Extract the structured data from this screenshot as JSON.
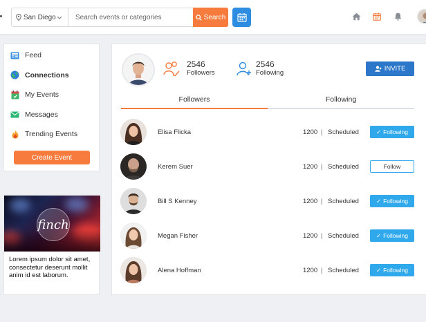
{
  "header": {
    "location": "San Diego",
    "search_placeholder": "Search events or categories",
    "search_label": "Search",
    "icons": [
      "calendar-icon",
      "home-icon",
      "calendar-icon",
      "bell-icon"
    ],
    "accent": "#f67b3c",
    "brand_blue": "#2e8de0"
  },
  "sidebar": {
    "items": [
      {
        "label": "Feed",
        "icon": "newspaper-icon"
      },
      {
        "label": "Connections",
        "icon": "globe-icon",
        "active": true
      },
      {
        "label": "My Events",
        "icon": "calendar-icon"
      },
      {
        "label": "Messages",
        "icon": "mail-icon"
      },
      {
        "label": "Trending Events",
        "icon": "fire-icon"
      }
    ],
    "create_label": "Create Event"
  },
  "ad": {
    "logo_text": "finch",
    "text": "Lorem ipsum dolor sit amet, consectetur deserunt mollit anim id est laborum."
  },
  "profile": {
    "followers_count": "2546",
    "followers_label": "Followers",
    "following_count": "2546",
    "following_label": "Following",
    "invite_label": "INVITE"
  },
  "tabs": [
    {
      "label": "Followers",
      "active": true
    },
    {
      "label": "Following",
      "active": false
    }
  ],
  "followers": [
    {
      "name": "Elisa Flicka",
      "count": "1200",
      "status": "Scheduled",
      "button": "Following",
      "following": true
    },
    {
      "name": "Kerem Suer",
      "count": "1200",
      "status": "Scheduled",
      "button": "Follow",
      "following": false
    },
    {
      "name": "Bill S Kenney",
      "count": "1200",
      "status": "Scheduled",
      "button": "Following",
      "following": true
    },
    {
      "name": "Megan Fisher",
      "count": "1200",
      "status": "Scheduled",
      "button": "Following",
      "following": true
    },
    {
      "name": "Alena Hoffman",
      "count": "1200",
      "status": "Scheduled",
      "button": "Following",
      "following": true
    }
  ],
  "separator": "|"
}
